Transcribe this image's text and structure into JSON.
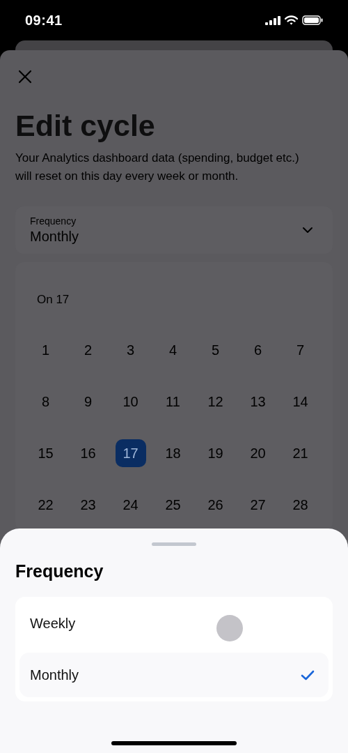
{
  "status_bar": {
    "time": "09:41"
  },
  "edit_sheet": {
    "title": "Edit cycle",
    "description": "Your Analytics dashboard data (spending, budget etc.) will reset on this day every week or month.",
    "frequency_field": {
      "label": "Frequency",
      "value": "Monthly"
    },
    "day_picker": {
      "caption": "On 17",
      "days": [
        {
          "label": "1",
          "selected": false
        },
        {
          "label": "2",
          "selected": false
        },
        {
          "label": "3",
          "selected": false
        },
        {
          "label": "4",
          "selected": false
        },
        {
          "label": "5",
          "selected": false
        },
        {
          "label": "6",
          "selected": false
        },
        {
          "label": "7",
          "selected": false
        },
        {
          "label": "8",
          "selected": false
        },
        {
          "label": "9",
          "selected": false
        },
        {
          "label": "10",
          "selected": false
        },
        {
          "label": "11",
          "selected": false
        },
        {
          "label": "12",
          "selected": false
        },
        {
          "label": "13",
          "selected": false
        },
        {
          "label": "14",
          "selected": false
        },
        {
          "label": "15",
          "selected": false
        },
        {
          "label": "16",
          "selected": false
        },
        {
          "label": "17",
          "selected": true
        },
        {
          "label": "18",
          "selected": false
        },
        {
          "label": "19",
          "selected": false
        },
        {
          "label": "20",
          "selected": false
        },
        {
          "label": "21",
          "selected": false
        },
        {
          "label": "22",
          "selected": false
        },
        {
          "label": "23",
          "selected": false
        },
        {
          "label": "24",
          "selected": false
        },
        {
          "label": "25",
          "selected": false
        },
        {
          "label": "26",
          "selected": false
        },
        {
          "label": "27",
          "selected": false
        },
        {
          "label": "28",
          "selected": false
        }
      ]
    }
  },
  "frequency_sheet": {
    "title": "Frequency",
    "options": [
      {
        "label": "Weekly",
        "selected": false
      },
      {
        "label": "Monthly",
        "selected": true
      }
    ]
  }
}
